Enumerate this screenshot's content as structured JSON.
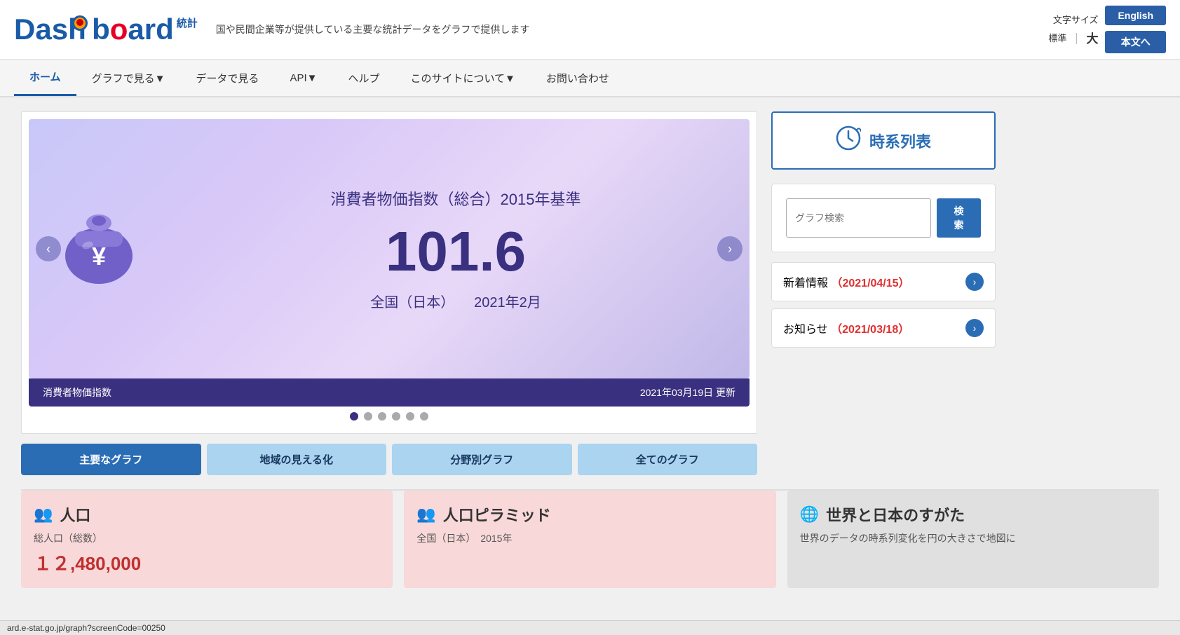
{
  "header": {
    "logo_main": "Dashboard",
    "logo_stat": "統計",
    "tagline": "国や民間企業等が提供している主要な統計データをグラフで提供します",
    "font_size_label": "文字サイズ",
    "font_std": "標準",
    "font_divider": "｜",
    "font_large": "大",
    "btn_english": "English",
    "btn_honbun": "本文へ"
  },
  "nav": {
    "items": [
      {
        "label": "ホーム",
        "active": true
      },
      {
        "label": "グラフで見る▼",
        "active": false
      },
      {
        "label": "データで見る",
        "active": false
      },
      {
        "label": "API▼",
        "active": false
      },
      {
        "label": "ヘルプ",
        "active": false
      },
      {
        "label": "このサイトについて▼",
        "active": false
      },
      {
        "label": "お問い合わせ",
        "active": false
      }
    ]
  },
  "carousel": {
    "title": "消費者物価指数（総合）2015年基準",
    "value": "101.6",
    "subtitle_location": "全国（日本）",
    "subtitle_date": "2021年2月",
    "footer_left": "消費者物価指数",
    "footer_right": "2021年03月19日 更新",
    "dots": [
      1,
      2,
      3,
      4,
      5,
      6
    ],
    "active_dot": 0,
    "prev_arrow": "‹",
    "next_arrow": "›"
  },
  "tabs": [
    {
      "label": "主要なグラフ",
      "primary": true
    },
    {
      "label": "地域の見える化",
      "primary": false
    },
    {
      "label": "分野別グラフ",
      "primary": false
    },
    {
      "label": "全てのグラフ",
      "primary": false
    }
  ],
  "sidebar": {
    "time_series_label": "時系列表",
    "search_placeholder": "グラフ検索",
    "search_btn": "検索",
    "news": [
      {
        "label": "新着情報",
        "date": "（2021/04/15）"
      },
      {
        "label": "お知らせ",
        "date": "（2021/03/18）"
      }
    ]
  },
  "cards": [
    {
      "title": "人口",
      "subtitle": "総人口（総数）",
      "value": "1,2,480,000",
      "icon": "👥",
      "type": "pink"
    },
    {
      "title": "人口ピラミッド",
      "subtitle": "全国（日本）　2015年",
      "value": "",
      "icon": "👥",
      "type": "pink"
    },
    {
      "title": "世界と日本のすがた",
      "subtitle": "世界のデータの時系列変化を円の大きさで地図に",
      "value": "",
      "icon": "🌐",
      "type": "gray"
    }
  ],
  "statusbar": {
    "url": "ard.e-stat.go.jp/graph?screenCode=00250"
  }
}
